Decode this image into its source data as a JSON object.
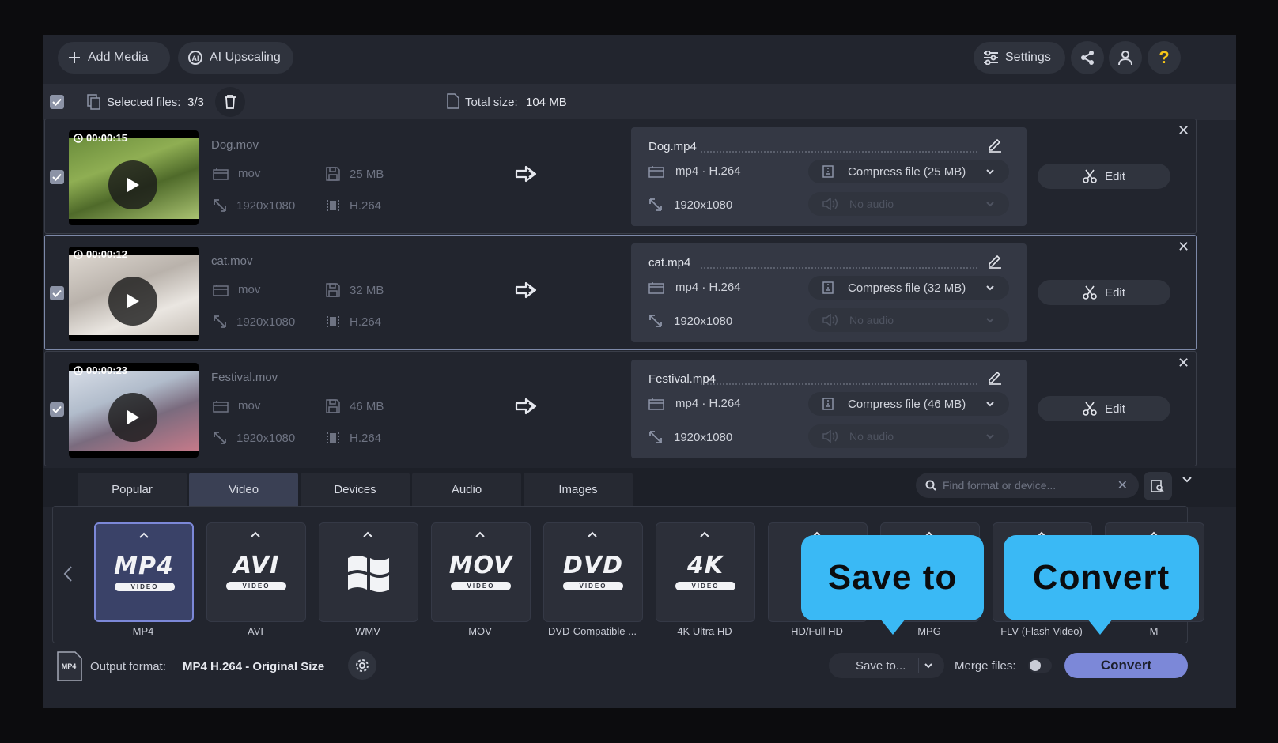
{
  "toolbar": {
    "add_media": "Add Media",
    "ai_upscaling": "AI Upscaling",
    "settings": "Settings"
  },
  "selection": {
    "selected_label": "Selected files:",
    "selected_value": "3/3",
    "total_label": "Total size:",
    "total_value": "104 MB"
  },
  "files": [
    {
      "duration": "00:00:15",
      "src_name": "Dog.mov",
      "src_ext": "mov",
      "src_size": "25 MB",
      "src_res": "1920x1080",
      "src_codec": "H.264",
      "out_name": "Dog.mp4",
      "out_format": "mp4 · H.264",
      "out_res": "1920x1080",
      "compress": "Compress file (25 MB)",
      "audio": "No audio",
      "edit": "Edit"
    },
    {
      "duration": "00:00:12",
      "src_name": "cat.mov",
      "src_ext": "mov",
      "src_size": "32 MB",
      "src_res": "1920x1080",
      "src_codec": "H.264",
      "out_name": "cat.mp4",
      "out_format": "mp4 · H.264",
      "out_res": "1920x1080",
      "compress": "Compress file (32 MB)",
      "audio": "No audio",
      "edit": "Edit"
    },
    {
      "duration": "00:00:23",
      "src_name": "Festival.mov",
      "src_ext": "mov",
      "src_size": "46 MB",
      "src_res": "1920x1080",
      "src_codec": "H.264",
      "out_name": "Festival.mp4",
      "out_format": "mp4 · H.264",
      "out_res": "1920x1080",
      "compress": "Compress file (46 MB)",
      "audio": "No audio",
      "edit": "Edit"
    }
  ],
  "tabs": [
    "Popular",
    "Video",
    "Devices",
    "Audio",
    "Images"
  ],
  "active_tab": "Video",
  "search_placeholder": "Find format or device...",
  "formats": [
    {
      "logo": "MP4",
      "sub": "VIDEO",
      "label": "MP4"
    },
    {
      "logo": "AVI",
      "sub": "VIDEO",
      "label": "AVI"
    },
    {
      "logo": "",
      "sub": "",
      "label": "WMV"
    },
    {
      "logo": "MOV",
      "sub": "VIDEO",
      "label": "MOV"
    },
    {
      "logo": "DVD",
      "sub": "VIDEO",
      "label": "DVD-Compatible ..."
    },
    {
      "logo": "4K",
      "sub": "VIDEO",
      "label": "4K Ultra HD"
    },
    {
      "logo": "",
      "sub": "",
      "label": "HD/Full HD"
    },
    {
      "logo": "",
      "sub": "",
      "label": "MPG"
    },
    {
      "logo": "",
      "sub": "",
      "label": "FLV (Flash Video)"
    },
    {
      "logo": "",
      "sub": "",
      "label": "M"
    }
  ],
  "bottom": {
    "output_label": "Output format:",
    "output_value": "MP4 H.264 - Original Size",
    "save_to": "Save to...",
    "merge_label": "Merge files:",
    "convert": "Convert"
  },
  "callouts": {
    "save_to": "Save to",
    "convert": "Convert"
  },
  "colors": {
    "accent": "#7c88d8",
    "callout": "#3ab9f5",
    "help": "#f5c518"
  }
}
